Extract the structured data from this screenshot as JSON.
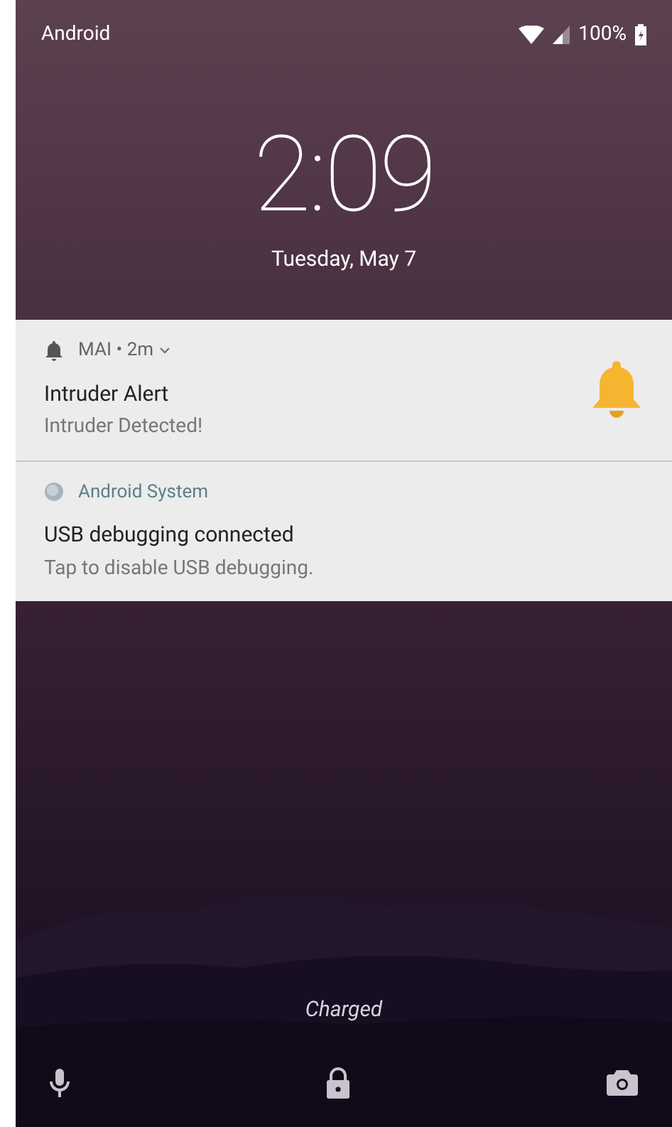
{
  "status_bar": {
    "carrier": "Android",
    "battery": "100%"
  },
  "clock": {
    "time": "2:09",
    "date": "Tuesday, May 7"
  },
  "notifications": [
    {
      "kind": "bell",
      "app": "MAI • 2m",
      "expandable": true,
      "title": "Intruder Alert",
      "text": "Intruder Detected!",
      "large_icon": true
    },
    {
      "kind": "system",
      "app": "Android System",
      "expandable": false,
      "title": "USB debugging connected",
      "text": "Tap to disable USB debugging."
    }
  ],
  "charging": "Charged"
}
